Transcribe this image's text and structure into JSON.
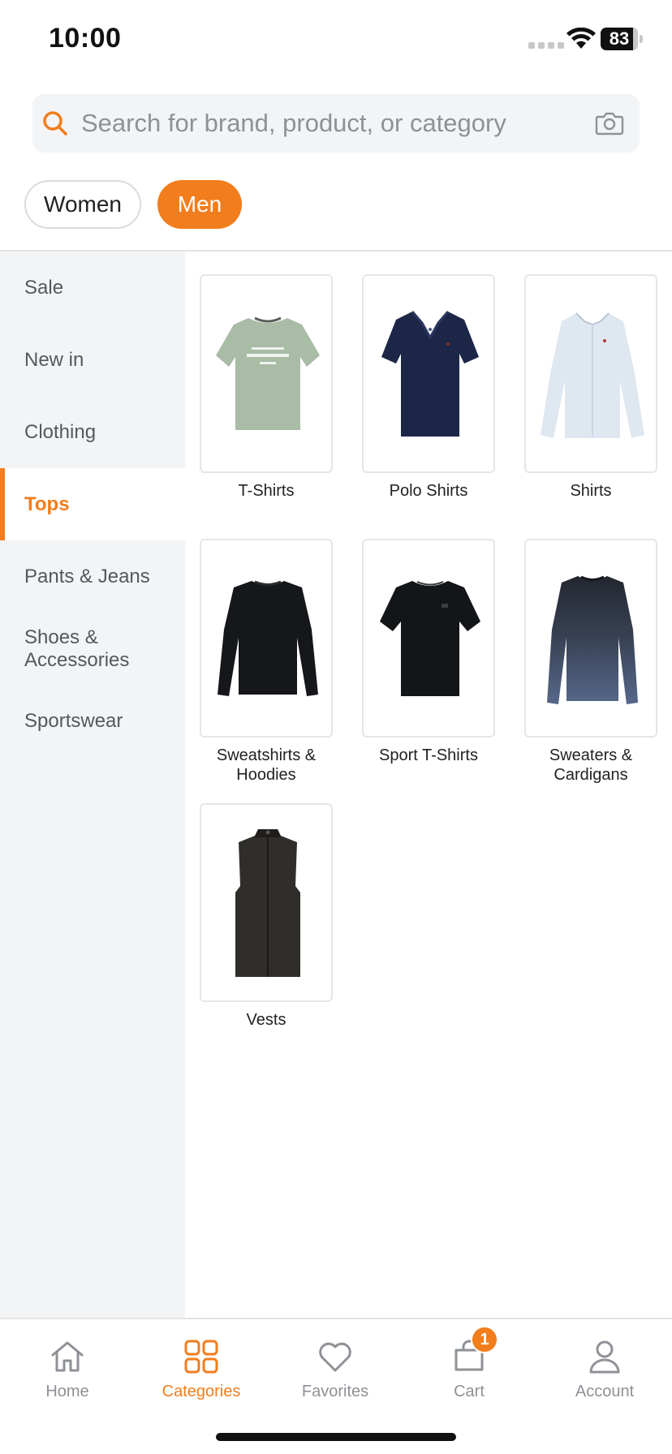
{
  "status_bar": {
    "time": "10:00",
    "battery": "83"
  },
  "search": {
    "placeholder": "Search for brand, product, or category",
    "value": ""
  },
  "gender_tabs": [
    {
      "label": "Women",
      "selected": false
    },
    {
      "label": "Men",
      "selected": true
    }
  ],
  "sidebar": {
    "items": [
      {
        "label": "Sale",
        "active": false
      },
      {
        "label": "New in",
        "active": false
      },
      {
        "label": "Clothing",
        "active": false
      },
      {
        "label": "Tops",
        "active": true
      },
      {
        "label": "Pants & Jeans",
        "active": false
      },
      {
        "label": "Shoes & Accessories",
        "active": false
      },
      {
        "label": "Sportswear",
        "active": false
      }
    ]
  },
  "categories": [
    {
      "label": "T-Shirts",
      "image": "sage-tshirt"
    },
    {
      "label": "Polo Shirts",
      "image": "navy-polo"
    },
    {
      "label": "Shirts",
      "image": "light-blue-shirt"
    },
    {
      "label": "Sweatshirts & Hoodies",
      "image": "black-sweatshirt"
    },
    {
      "label": "Sport T-Shirts",
      "image": "black-sport-tshirt"
    },
    {
      "label": "Sweaters & Cardigans",
      "image": "blue-sweater"
    },
    {
      "label": "Vests",
      "image": "dark-vest"
    }
  ],
  "bottom_nav": {
    "items": [
      {
        "label": "Home",
        "icon": "home-icon",
        "active": false
      },
      {
        "label": "Categories",
        "icon": "grid-icon",
        "active": true
      },
      {
        "label": "Favorites",
        "icon": "heart-icon",
        "active": false
      },
      {
        "label": "Cart",
        "icon": "cart-icon",
        "active": false,
        "badge": "1"
      },
      {
        "label": "Account",
        "icon": "user-icon",
        "active": false
      }
    ]
  },
  "colors": {
    "accent": "#f27d1c",
    "sidebar_bg": "#f3f4f6",
    "text_muted": "#8e9196"
  }
}
